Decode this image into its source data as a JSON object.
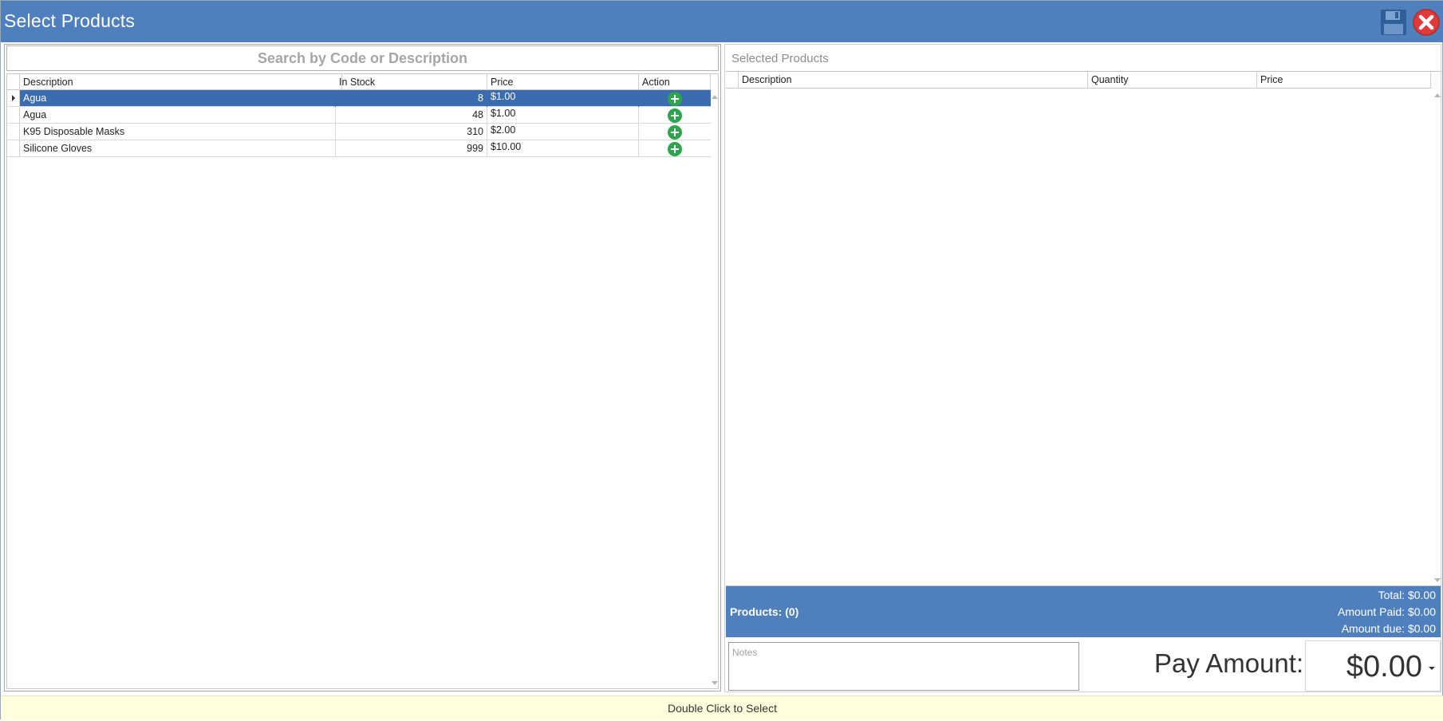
{
  "window": {
    "title": "Select Products"
  },
  "search": {
    "placeholder": "Search by Code or Description"
  },
  "products_grid": {
    "columns": [
      "Description",
      "In Stock",
      "Price",
      "Action"
    ],
    "rows": [
      {
        "description": "Agua",
        "in_stock": "8",
        "price": "$1.00",
        "selected": true
      },
      {
        "description": "Agua",
        "in_stock": "48",
        "price": "$1.00",
        "selected": false
      },
      {
        "description": "K95 Disposable Masks",
        "in_stock": "310",
        "price": "$2.00",
        "selected": false
      },
      {
        "description": "Silicone Gloves",
        "in_stock": "999",
        "price": "$10.00",
        "selected": false
      }
    ],
    "action_icon": "add-circle-icon"
  },
  "selected_products": {
    "title": "Selected Products",
    "columns": [
      "Description",
      "Quantity",
      "Price"
    ]
  },
  "summary": {
    "products_count": "Products: (0)",
    "total": "Total: $0.00",
    "amount_paid": "Amount Paid: $0.00",
    "amount_due": "Amount due: $0.00"
  },
  "notes": {
    "placeholder": "Notes"
  },
  "pay": {
    "label": "Pay Amount:",
    "value": "$0.00"
  },
  "status": {
    "hint": "Double Click to Select"
  },
  "colors": {
    "accent": "#4f80bd",
    "selected_row": "#3b6cb0",
    "add_button": "#2ea44f",
    "close_button": "#e0393a",
    "status_bg": "#ffffdd"
  }
}
